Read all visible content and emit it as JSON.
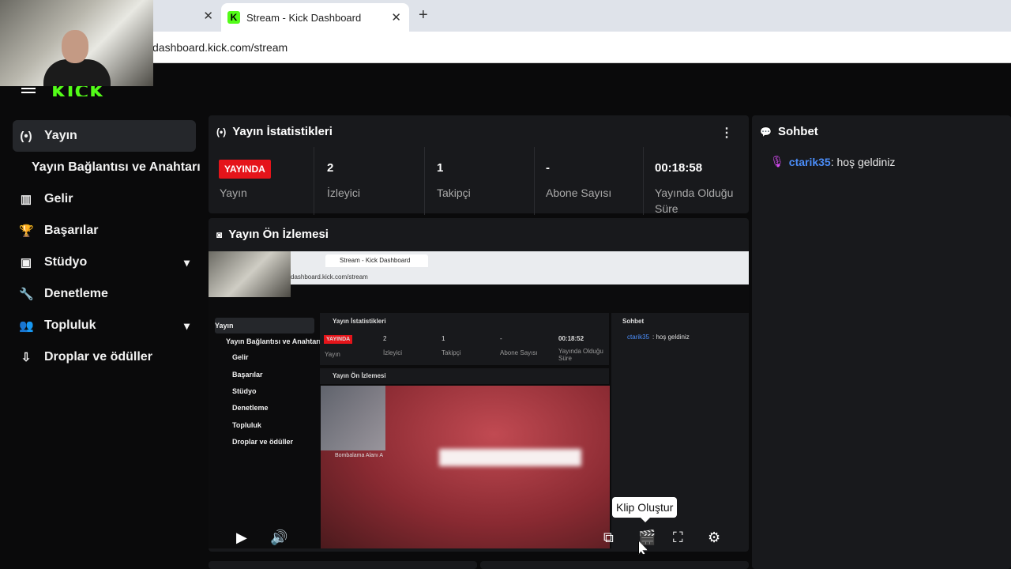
{
  "browser": {
    "tabs": [
      {
        "label": ""
      },
      {
        "label": "Stream - Kick Dashboard"
      }
    ],
    "new_tab": "+",
    "close": "✕",
    "url": "dashboard.kick.com/stream"
  },
  "brand": {
    "logo": "KICK",
    "accent": "#53fc18"
  },
  "sidebar": {
    "items": [
      {
        "label": "Yayın",
        "icon": "broadcast-icon"
      },
      {
        "label": "Yayın Bağlantısı ve Anahtarı"
      },
      {
        "label": "Gelir",
        "icon": "chart-icon"
      },
      {
        "label": "Başarılar",
        "icon": "trophy-icon"
      },
      {
        "label": "Stüdyo",
        "icon": "studio-icon"
      },
      {
        "label": "Denetleme",
        "icon": "wrench-icon"
      },
      {
        "label": "Topluluk",
        "icon": "people-icon"
      },
      {
        "label": "Droplar ve ödüller",
        "icon": "gift-icon"
      }
    ]
  },
  "stats": {
    "title": "Yayın İstatistikleri",
    "live_badge": "YAYINDA",
    "items": [
      {
        "value": "",
        "label": "Yayın"
      },
      {
        "value": "2",
        "label": "İzleyici"
      },
      {
        "value": "1",
        "label": "Takipçi"
      },
      {
        "value": "-",
        "label": "Abone Sayısı"
      },
      {
        "value": "00:18:58",
        "label": "Yayında Olduğu Süre"
      }
    ]
  },
  "preview": {
    "title": "Yayın Ön İzlemesi",
    "mini": {
      "tab": "Stream - Kick Dashboard",
      "url": "dashboard.kick.com/stream",
      "stats_title": "Yayın İstatistikleri",
      "live_badge": "YAYINDA",
      "viewers": "2",
      "viewers_label": "İzleyici",
      "followers": "1",
      "followers_label": "Takipçi",
      "subs": "-",
      "subs_label": "Abone Sayısı",
      "duration": "00:18:52",
      "duration_label": "Yayında Olduğu Süre",
      "stream_label": "Yayın",
      "preview_title": "Yayın Ön İzlemesi",
      "chat_title": "Sohbet",
      "chat_user": "ctarik35",
      "chat_text": ": hoş geldiniz",
      "game_caption": "Bombalama Alanı A",
      "nav": [
        "Yayın",
        "Yayın Bağlantısı ve Anahtarı",
        "Gelir",
        "Başarılar",
        "Stüdyo",
        "Denetleme",
        "Topluluk",
        "Droplar ve ödüller"
      ]
    },
    "tooltip": "Klip Oluştur"
  },
  "chat": {
    "title": "Sohbet",
    "messages": [
      {
        "user": "ctarik35",
        "text": ": hoş geldiniz"
      }
    ]
  }
}
